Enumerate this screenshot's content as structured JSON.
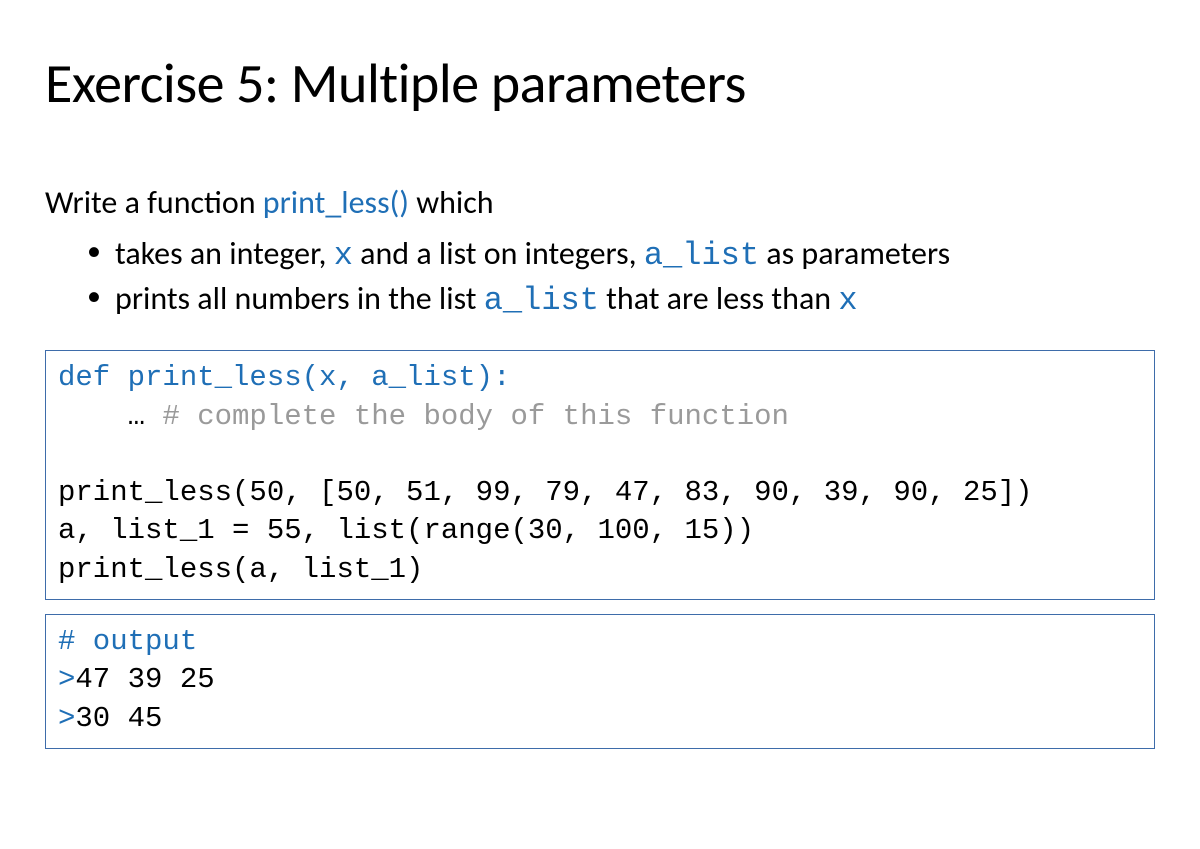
{
  "title": "Exercise 5: Multiple parameters",
  "intro": {
    "pre": "Write a function ",
    "fn": "print_less()",
    "post": " which"
  },
  "bullets": {
    "b1": {
      "t1": "takes an integer, ",
      "code1": "x",
      "t2": " and a list on integers, ",
      "code2": "a_list",
      "t3": " as parameters"
    },
    "b2": {
      "t1": "prints all numbers in the list ",
      "code1": "a_list",
      "t2": " that are less than ",
      "code2": "x"
    }
  },
  "code1": {
    "line1": "def print_less(x, a_list):",
    "line2a": "    … ",
    "line2b": "# complete the body of this function",
    "blank": "",
    "line3": "print_less(50, [50, 51, 99, 79, 47, 83, 90, 39, 90, 25])",
    "line4": "a, list_1 = 55, list(range(30, 100, 15))",
    "line5": "print_less(a, list_1)"
  },
  "code2": {
    "line1": "# output",
    "line2a": ">",
    "line2b": "47 39 25",
    "line3a": ">",
    "line3b": "30 45"
  }
}
